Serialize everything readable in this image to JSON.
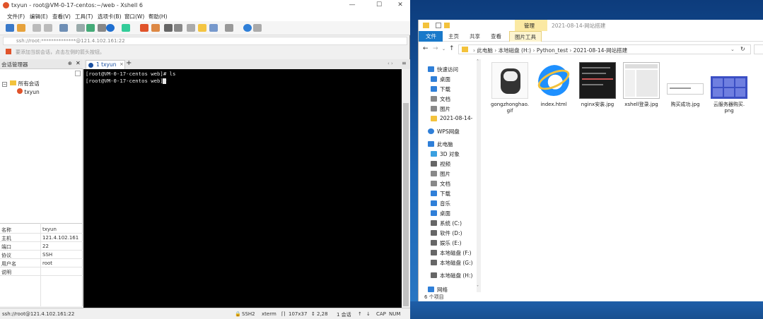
{
  "xshell": {
    "title": "txyun - root@VM-0-17-centos:~/web - Xshell 6",
    "menu": [
      "文件(F)",
      "编辑(E)",
      "查看(V)",
      "工具(T)",
      "选项卡(B)",
      "窗口(W)",
      "帮助(H)"
    ],
    "address": "ssh://root:**************@121.4.102.161:22",
    "hint": "要添加当前会话，点击左侧的箭头按钮。",
    "session_panel_title": "会话管理器",
    "tree": {
      "root": "所有会话",
      "child": "txyun"
    },
    "props": [
      {
        "k": "名称",
        "v": "txyun"
      },
      {
        "k": "主机",
        "v": "121.4.102.161"
      },
      {
        "k": "端口",
        "v": "22"
      },
      {
        "k": "协议",
        "v": "SSH"
      },
      {
        "k": "用户名",
        "v": "root"
      },
      {
        "k": "说明",
        "v": ""
      }
    ],
    "tab_label": "1 txyun",
    "terminal_text": "[root@VM-0-17-centos web]# ls\n[root@VM-0-17-centos web]#",
    "status": {
      "left": "ssh://root@121.4.102.161:22",
      "proto": "SSH2",
      "term": "xterm",
      "size": "107x37",
      "pos": "2,28",
      "sessions": "1 会话",
      "cap": "CAP",
      "num": "NUM"
    }
  },
  "explorer": {
    "title_tab": "管理",
    "title_path": "2021-08-14-网站搭建",
    "ribbon_tabs": [
      "文件",
      "主页",
      "共享",
      "查看",
      "图片工具"
    ],
    "breadcrumb": [
      "此电脑",
      "本地磁盘 (H:)",
      "Python_test",
      "2021-08-14-网站搭建"
    ],
    "nav": [
      {
        "label": "快速访问",
        "color": "#2f7fd8"
      },
      {
        "label": "桌面",
        "color": "#2f7fd8"
      },
      {
        "label": "下载",
        "color": "#2f7fd8"
      },
      {
        "label": "文档",
        "color": "#888"
      },
      {
        "label": "图片",
        "color": "#888"
      },
      {
        "label": "2021-08-14-",
        "color": "#f3c23c"
      },
      {
        "label": "WPS网盘",
        "color": "#2f7fd8"
      },
      {
        "label": "此电脑",
        "color": "#2f7fd8"
      },
      {
        "label": "3D 对象",
        "color": "#3aa0e0"
      },
      {
        "label": "视频",
        "color": "#666"
      },
      {
        "label": "图片",
        "color": "#888"
      },
      {
        "label": "文档",
        "color": "#888"
      },
      {
        "label": "下载",
        "color": "#2f7fd8"
      },
      {
        "label": "音乐",
        "color": "#2f7fd8"
      },
      {
        "label": "桌面",
        "color": "#2f7fd8"
      },
      {
        "label": "系统 (C:)",
        "color": "#666"
      },
      {
        "label": "软件 (D:)",
        "color": "#666"
      },
      {
        "label": "娱乐 (E:)",
        "color": "#666"
      },
      {
        "label": "本地磁盘 (F:)",
        "color": "#666"
      },
      {
        "label": "本地磁盘 (G:)",
        "color": "#666"
      },
      {
        "label": "本地磁盘 (H:)",
        "color": "#666"
      },
      {
        "label": "网络",
        "color": "#2f7fd8"
      }
    ],
    "files": [
      {
        "name": "gongzhonghao.\ngif",
        "kind": "gif"
      },
      {
        "name": "index.html",
        "kind": "ie"
      },
      {
        "name": "nginx安装.jpg",
        "kind": "dark"
      },
      {
        "name": "xshell登录.jpg",
        "kind": "shot"
      },
      {
        "name": "购买成功.jpg",
        "kind": "blank"
      },
      {
        "name": "云服务器购买.\npng",
        "kind": "blue"
      }
    ],
    "item_count": "6 个项目"
  }
}
